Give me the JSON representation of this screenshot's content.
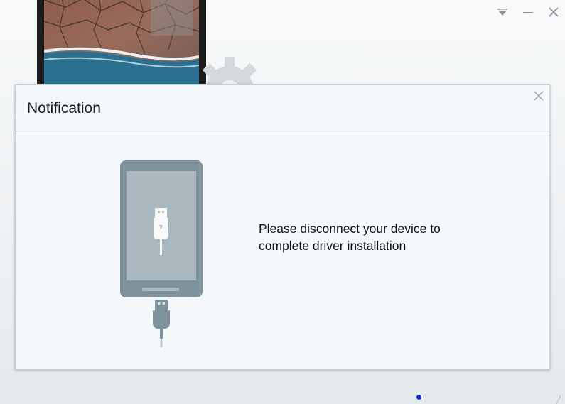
{
  "window": {
    "controls": [
      {
        "name": "dropdown-menu-icon"
      },
      {
        "name": "minimize-icon"
      },
      {
        "name": "close-icon"
      }
    ]
  },
  "dialog": {
    "title": "Notification",
    "message_line1": "Please disconnect your device to",
    "message_line2": "complete driver installation",
    "illustration_icon": "phone-usb-disconnect-icon",
    "close_icon": "close-icon"
  },
  "colors": {
    "accent_dot": "#1a2ed1",
    "illustration_phone": "#7f939c",
    "illustration_screen": "#a9b8bf",
    "dialog_bg": "#f4f8fb"
  }
}
